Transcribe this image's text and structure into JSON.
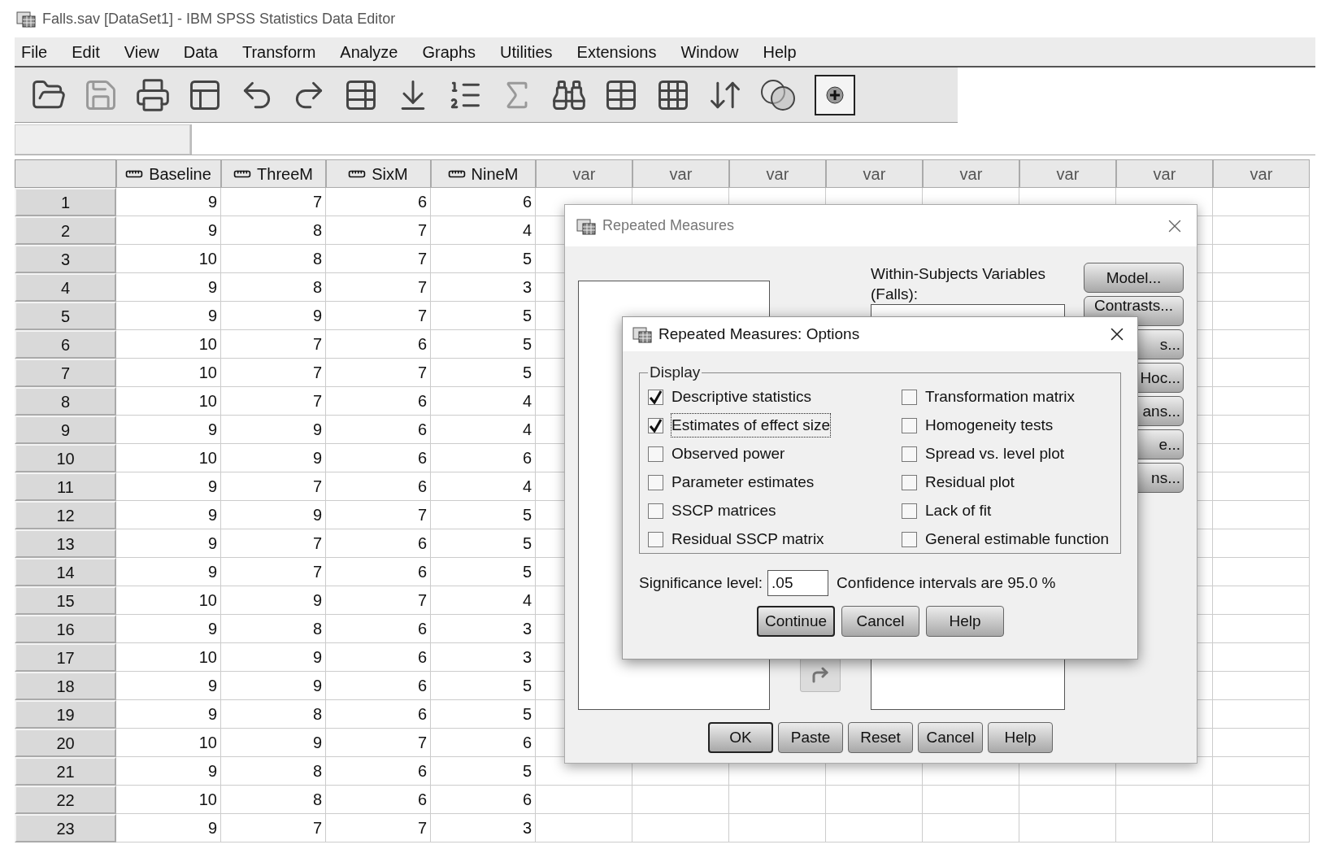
{
  "window": {
    "title": "Falls.sav [DataSet1] - IBM SPSS Statistics Data Editor"
  },
  "menu": [
    {
      "label": "File"
    },
    {
      "label": "Edit"
    },
    {
      "label": "View"
    },
    {
      "label": "Data"
    },
    {
      "label": "Transform"
    },
    {
      "label": "Analyze"
    },
    {
      "label": "Graphs"
    },
    {
      "label": "Utilities"
    },
    {
      "label": "Extensions"
    },
    {
      "label": "Window"
    },
    {
      "label": "Help"
    }
  ],
  "grid": {
    "columns": [
      {
        "name": "Baseline",
        "kind": "variable"
      },
      {
        "name": "ThreeM",
        "kind": "variable"
      },
      {
        "name": "SixM",
        "kind": "variable"
      },
      {
        "name": "NineM",
        "kind": "variable"
      },
      {
        "name": "var",
        "kind": "empty"
      },
      {
        "name": "var",
        "kind": "empty"
      },
      {
        "name": "var",
        "kind": "empty"
      },
      {
        "name": "var",
        "kind": "empty"
      },
      {
        "name": "var",
        "kind": "empty"
      },
      {
        "name": "var",
        "kind": "empty"
      },
      {
        "name": "var",
        "kind": "empty"
      },
      {
        "name": "var",
        "kind": "empty"
      }
    ],
    "rows": [
      {
        "case": "1",
        "values": [
          "9",
          "7",
          "6",
          "6"
        ]
      },
      {
        "case": "2",
        "values": [
          "9",
          "8",
          "7",
          "4"
        ]
      },
      {
        "case": "3",
        "values": [
          "10",
          "8",
          "7",
          "5"
        ]
      },
      {
        "case": "4",
        "values": [
          "9",
          "8",
          "7",
          "3"
        ]
      },
      {
        "case": "5",
        "values": [
          "9",
          "9",
          "7",
          "5"
        ]
      },
      {
        "case": "6",
        "values": [
          "10",
          "7",
          "6",
          "5"
        ]
      },
      {
        "case": "7",
        "values": [
          "10",
          "7",
          "7",
          "5"
        ]
      },
      {
        "case": "8",
        "values": [
          "10",
          "7",
          "6",
          "4"
        ]
      },
      {
        "case": "9",
        "values": [
          "9",
          "9",
          "6",
          "4"
        ]
      },
      {
        "case": "10",
        "values": [
          "10",
          "9",
          "6",
          "6"
        ]
      },
      {
        "case": "11",
        "values": [
          "9",
          "7",
          "6",
          "4"
        ]
      },
      {
        "case": "12",
        "values": [
          "9",
          "9",
          "7",
          "5"
        ]
      },
      {
        "case": "13",
        "values": [
          "9",
          "7",
          "6",
          "5"
        ]
      },
      {
        "case": "14",
        "values": [
          "9",
          "7",
          "6",
          "5"
        ]
      },
      {
        "case": "15",
        "values": [
          "10",
          "9",
          "7",
          "4"
        ]
      },
      {
        "case": "16",
        "values": [
          "9",
          "8",
          "6",
          "3"
        ]
      },
      {
        "case": "17",
        "values": [
          "10",
          "9",
          "6",
          "3"
        ]
      },
      {
        "case": "18",
        "values": [
          "9",
          "9",
          "6",
          "5"
        ]
      },
      {
        "case": "19",
        "values": [
          "9",
          "8",
          "6",
          "5"
        ]
      },
      {
        "case": "20",
        "values": [
          "10",
          "9",
          "7",
          "6"
        ]
      },
      {
        "case": "21",
        "values": [
          "9",
          "8",
          "6",
          "5"
        ]
      },
      {
        "case": "22",
        "values": [
          "10",
          "8",
          "6",
          "6"
        ]
      },
      {
        "case": "23",
        "values": [
          "9",
          "7",
          "7",
          "3"
        ]
      }
    ]
  },
  "main_dialog": {
    "title": "Repeated Measures",
    "within_label": "Within-Subjects Variables (Falls):",
    "side_buttons": [
      {
        "label": "Model...",
        "kind": "full"
      },
      {
        "label": "Contrasts...",
        "kind": "full"
      },
      {
        "label": "s...",
        "kind": "partial"
      },
      {
        "label": "Hoc...",
        "kind": "partial"
      },
      {
        "label": "ans...",
        "kind": "partial"
      },
      {
        "label": "e...",
        "kind": "partial"
      },
      {
        "label": "ns...",
        "kind": "partial"
      }
    ],
    "buttons": [
      {
        "label": "OK",
        "default": true
      },
      {
        "label": "Paste",
        "default": false
      },
      {
        "label": "Reset",
        "default": false
      },
      {
        "label": "Cancel",
        "default": false
      },
      {
        "label": "Help",
        "default": false
      }
    ]
  },
  "options_dialog": {
    "title": "Repeated Measures: Options",
    "group": "Display",
    "options": [
      {
        "label": "Descriptive statistics",
        "checked": true,
        "focused": false
      },
      {
        "label": "Transformation matrix",
        "checked": false,
        "focused": false
      },
      {
        "label": "Estimates of effect size",
        "checked": true,
        "focused": true
      },
      {
        "label": "Homogeneity tests",
        "checked": false,
        "focused": false
      },
      {
        "label": "Observed power",
        "checked": false,
        "focused": false
      },
      {
        "label": "Spread vs. level plot",
        "checked": false,
        "focused": false
      },
      {
        "label": "Parameter estimates",
        "checked": false,
        "focused": false
      },
      {
        "label": "Residual plot",
        "checked": false,
        "focused": false
      },
      {
        "label": "SSCP matrices",
        "checked": false,
        "focused": false
      },
      {
        "label": "Lack of fit",
        "checked": false,
        "focused": false
      },
      {
        "label": "Residual SSCP matrix",
        "checked": false,
        "focused": false
      },
      {
        "label": "General estimable function",
        "checked": false,
        "focused": false
      }
    ],
    "significance_label": "Significance level:",
    "significance_value": ".05",
    "confidence_text": "Confidence intervals are 95.0 %",
    "buttons": [
      {
        "label": "Continue",
        "default": true
      },
      {
        "label": "Cancel",
        "default": false
      },
      {
        "label": "Help",
        "default": false
      }
    ]
  }
}
